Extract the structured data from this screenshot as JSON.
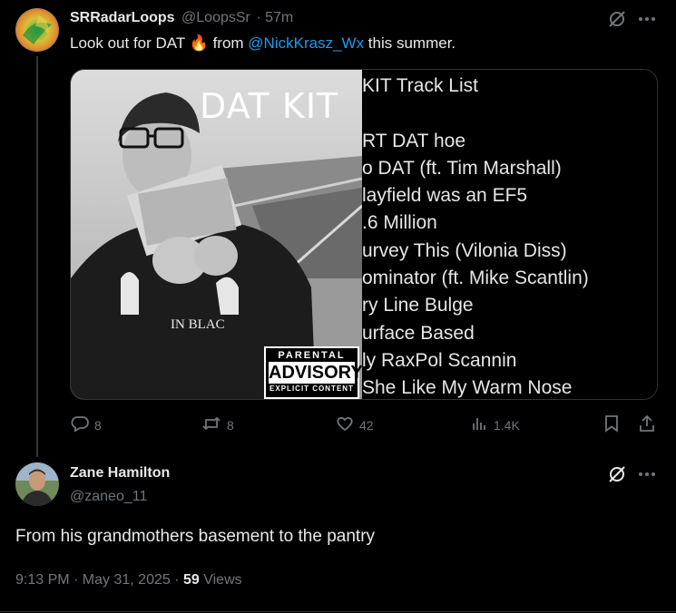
{
  "tweet": {
    "author_name": "SRRadarLoops",
    "author_handle": "@LoopsSr",
    "time": "· 57m",
    "text_before": "Look out  for DAT ",
    "emoji": "🔥",
    "text_mid": " from ",
    "mention": "@NickKrasz_Wx",
    "text_after": " this summer.",
    "image": {
      "album_title": "DAT KIT",
      "advisory_line1": "PARENTAL",
      "advisory_line2": "ADVISORY",
      "advisory_line3": "EXPLICIT CONTENT",
      "tracklist_title": "KIT Track List",
      "tracks": [
        "RT DAT hoe",
        "o DAT (ft. Tim Marshall)",
        "layfield was an EF5",
        ".6 Million",
        "urvey This (Vilonia Diss)",
        "ominator (ft. Mike Scantlin)",
        "ry Line Bulge",
        "urface Based",
        "ly RaxPol Scannin",
        "She Like My Warm Nose"
      ]
    },
    "stats": {
      "replies": "8",
      "retweets": "8",
      "likes": "42",
      "views": "1.4K"
    }
  },
  "reply": {
    "author_name": "Zane Hamilton",
    "author_handle": "@zaneo_11",
    "text": "From his grandmothers basement to the pantry",
    "timestamp": "9:13 PM · May 31, 2025 · ",
    "views_count": "59",
    "views_label": " Views"
  },
  "icons": [
    "grok-icon",
    "more-icon",
    "reply-icon",
    "retweet-icon",
    "like-icon",
    "views-icon",
    "bookmark-icon",
    "share-icon"
  ],
  "colors": {
    "background": "#000000",
    "text": "#e7e9ea",
    "muted": "#71767b",
    "link": "#1d9bf0",
    "border": "#2f3336"
  }
}
